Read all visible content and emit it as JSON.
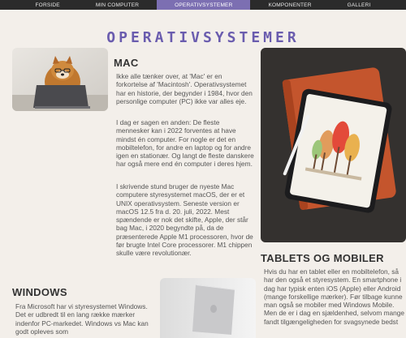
{
  "nav": {
    "items": [
      {
        "label": "FORSIDE"
      },
      {
        "label": "MIN COMPUTER"
      },
      {
        "label": "OPERATIVSYSTEMER"
      },
      {
        "label": "KOMPONENTER"
      },
      {
        "label": "GALLERI"
      }
    ],
    "active_index": 2
  },
  "page": {
    "title": "OPERATIVSYSTEMER"
  },
  "mac": {
    "heading": "MAC",
    "paragraphs": [
      "Ikke alle tænker over, at 'Mac' er en forkortelse af 'Macintosh'. Operativsystemet har en historie, der begynder i 1984, hvor den personlige computer (PC) ikke var alles eje.",
      "I dag er sagen en anden: De fleste mennesker kan i 2022 forventes at have mindst én computer. For nogle er det en mobiltelefon, for andre en laptop og for andre igen en stationær. Og langt de fleste danskere har også mere end én computer i deres hjem.",
      "I skrivende stund bruger de nyeste Mac computere styresystemet macOS, der er et UNIX operativsystem. Seneste version er macOS 12.5 fra d. 20. juli, 2022. Mest spændende er nok det skifte, Apple, der står bag Mac, i 2020 begyndte på, da de præsenterede Apple M1 processoren, hvor de før brugte Intel Core processorer. M1 chippen skulle være revolutionær."
    ]
  },
  "tablets": {
    "heading": "TABLETS OG MOBILER",
    "paragraph": "Hvis du har en tablet eller en mobiltelefon, så har den også et styresystem. En smartphone i dag har typisk enten iOS (Apple) eller Android (mange forskellige mærker). Før tilbage kunne man også se mobiler med Windows Mobile. Men de er i dag en sjældenhed, selvom mange fandt tilgængeligheden for svagsynede bedst"
  },
  "windows": {
    "heading": "WINDOWS",
    "paragraph": "Fra Microsoft har vi styresystemet Windows. Det er udbredt til en lang række mærker indenfor PC-markedet. Windows vs Mac kan godt opleves som"
  },
  "colors": {
    "nav_bg": "#2b2b2b",
    "nav_active": "#7c6fb2",
    "title": "#6a5cae",
    "page_bg": "#f3efea"
  }
}
